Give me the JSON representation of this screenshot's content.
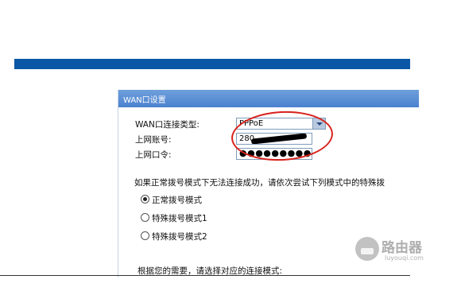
{
  "panel": {
    "title": "WAN口设置"
  },
  "fields": {
    "conn_type_label": "WAN口连接类型:",
    "conn_type_value": "PPPoE",
    "account_label": "上网账号:",
    "account_value": "280",
    "password_label": "上网口令:",
    "password_value": "●●●●●●●●●●●●●"
  },
  "note": "如果正常拨号模式下无法连接成功，请依次尝试下列模式中的特殊拨",
  "dial_modes": [
    {
      "label": "正常拨号模式",
      "checked": true
    },
    {
      "label": "特殊拨号模式1",
      "checked": false
    },
    {
      "label": "特殊拨号模式2",
      "checked": false
    }
  ],
  "bottom_text": "根据您的需要，请选择对应的连接模式:",
  "watermark": {
    "name": "路由器",
    "site": "luyouqi.com"
  },
  "colors": {
    "top_bar": "#0a57a6",
    "header": "#5b8fd6",
    "annotation": "#d9221c"
  }
}
